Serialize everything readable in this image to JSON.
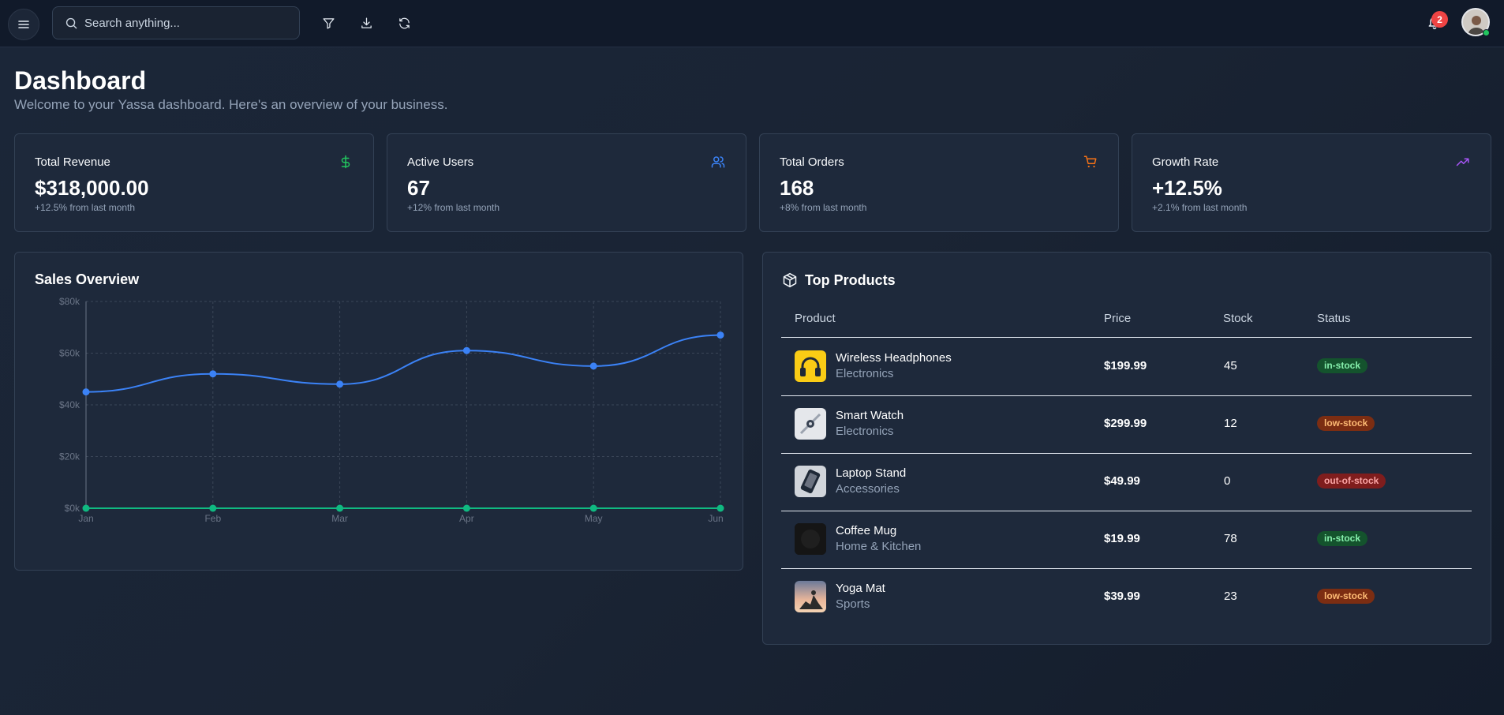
{
  "topbar": {
    "search_placeholder": "Search anything...",
    "notification_count": "2"
  },
  "header": {
    "title": "Dashboard",
    "subtitle": "Welcome to your Yassa dashboard. Here's an overview of your business."
  },
  "stats": [
    {
      "title": "Total Revenue",
      "value": "$318,000.00",
      "change": "+12.5% from last month",
      "icon": "dollar-icon",
      "color": "#22c55e"
    },
    {
      "title": "Active Users",
      "value": "67",
      "change": "+12% from last month",
      "icon": "users-icon",
      "color": "#3b82f6"
    },
    {
      "title": "Total Orders",
      "value": "168",
      "change": "+8% from last month",
      "icon": "cart-icon",
      "color": "#f97316"
    },
    {
      "title": "Growth Rate",
      "value": "+12.5%",
      "change": "+2.1% from last month",
      "icon": "trending-up-icon",
      "color": "#a855f7"
    }
  ],
  "sales": {
    "title": "Sales Overview"
  },
  "chart_data": {
    "type": "line",
    "categories": [
      "Jan",
      "Feb",
      "Mar",
      "Apr",
      "May",
      "Jun"
    ],
    "series": [
      {
        "values": [
          45000,
          52000,
          48000,
          61000,
          55000,
          67000
        ],
        "color": "#3b82f6"
      },
      {
        "values": [
          0,
          0,
          0,
          0,
          0,
          0
        ],
        "color": "#10b981"
      }
    ],
    "ylim": [
      0,
      80000
    ],
    "yticks": [
      "$0k",
      "$20k",
      "$40k",
      "$60k",
      "$80k"
    ],
    "grid": true
  },
  "products": {
    "title": "Top Products",
    "headers": {
      "product": "Product",
      "price": "Price",
      "stock": "Stock",
      "status": "Status"
    },
    "rows": [
      {
        "name": "Wireless Headphones",
        "category": "Electronics",
        "price": "$199.99",
        "stock": "45",
        "status": "in-stock"
      },
      {
        "name": "Smart Watch",
        "category": "Electronics",
        "price": "$299.99",
        "stock": "12",
        "status": "low-stock"
      },
      {
        "name": "Laptop Stand",
        "category": "Accessories",
        "price": "$49.99",
        "stock": "0",
        "status": "out-of-stock"
      },
      {
        "name": "Coffee Mug",
        "category": "Home & Kitchen",
        "price": "$19.99",
        "stock": "78",
        "status": "in-stock"
      },
      {
        "name": "Yoga Mat",
        "category": "Sports",
        "price": "$39.99",
        "stock": "23",
        "status": "low-stock"
      }
    ]
  }
}
